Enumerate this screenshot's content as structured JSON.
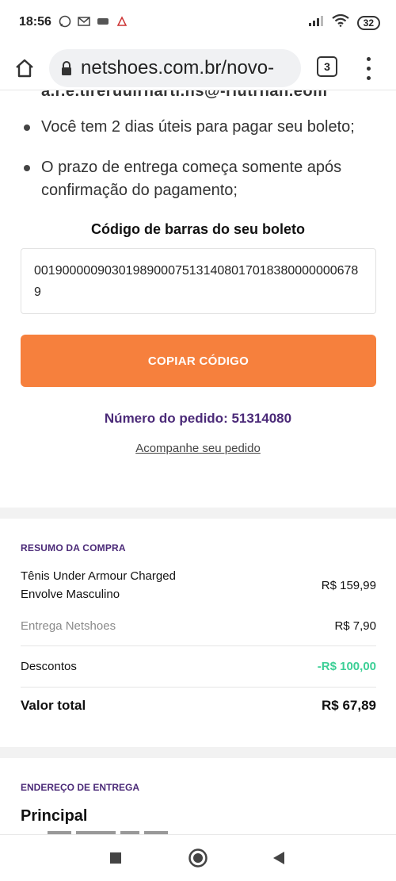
{
  "status_bar": {
    "time": "18:56",
    "left_icons": [
      "whatsapp-icon",
      "mail-icon",
      "app-icon",
      "notification-icon"
    ],
    "battery": "32"
  },
  "browser": {
    "url": "netshoes.com.br/novo-",
    "tab_count": "3"
  },
  "content": {
    "cut_email_fragment": "a.r.e.tireruuirnarti.ns@-riutrnan.eom",
    "bullets": [
      "Você tem 2 dias úteis para pagar seu boleto;",
      "O prazo de entrega começa somente após confirmação do pagamento;"
    ],
    "barcode_title": "Código de barras do seu boleto",
    "barcode_value": "00190000090301989000751314080170183800000006789",
    "copy_button": "COPIAR CÓDIGO",
    "order_number": "Número do pedido: 51314080",
    "track_link": "Acompanhe seu pedido"
  },
  "summary": {
    "title": "RESUMO DA COMPRA",
    "product_name": "Tênis Under Armour Charged Envolve Masculino",
    "product_price": "R$ 159,99",
    "shipping_label": "Entrega Netshoes",
    "shipping_price": "R$ 7,90",
    "discount_label": "Descontos",
    "discount_value": "-R$ 100,00",
    "total_label": "Valor total",
    "total_value": "R$ 67,89"
  },
  "address": {
    "title": "ENDEREÇO DE ENTREGA",
    "name": "Principal"
  },
  "colors": {
    "accent_orange": "#f6803d",
    "brand_purple": "#4b2a78",
    "discount_green": "#3ccf96"
  }
}
